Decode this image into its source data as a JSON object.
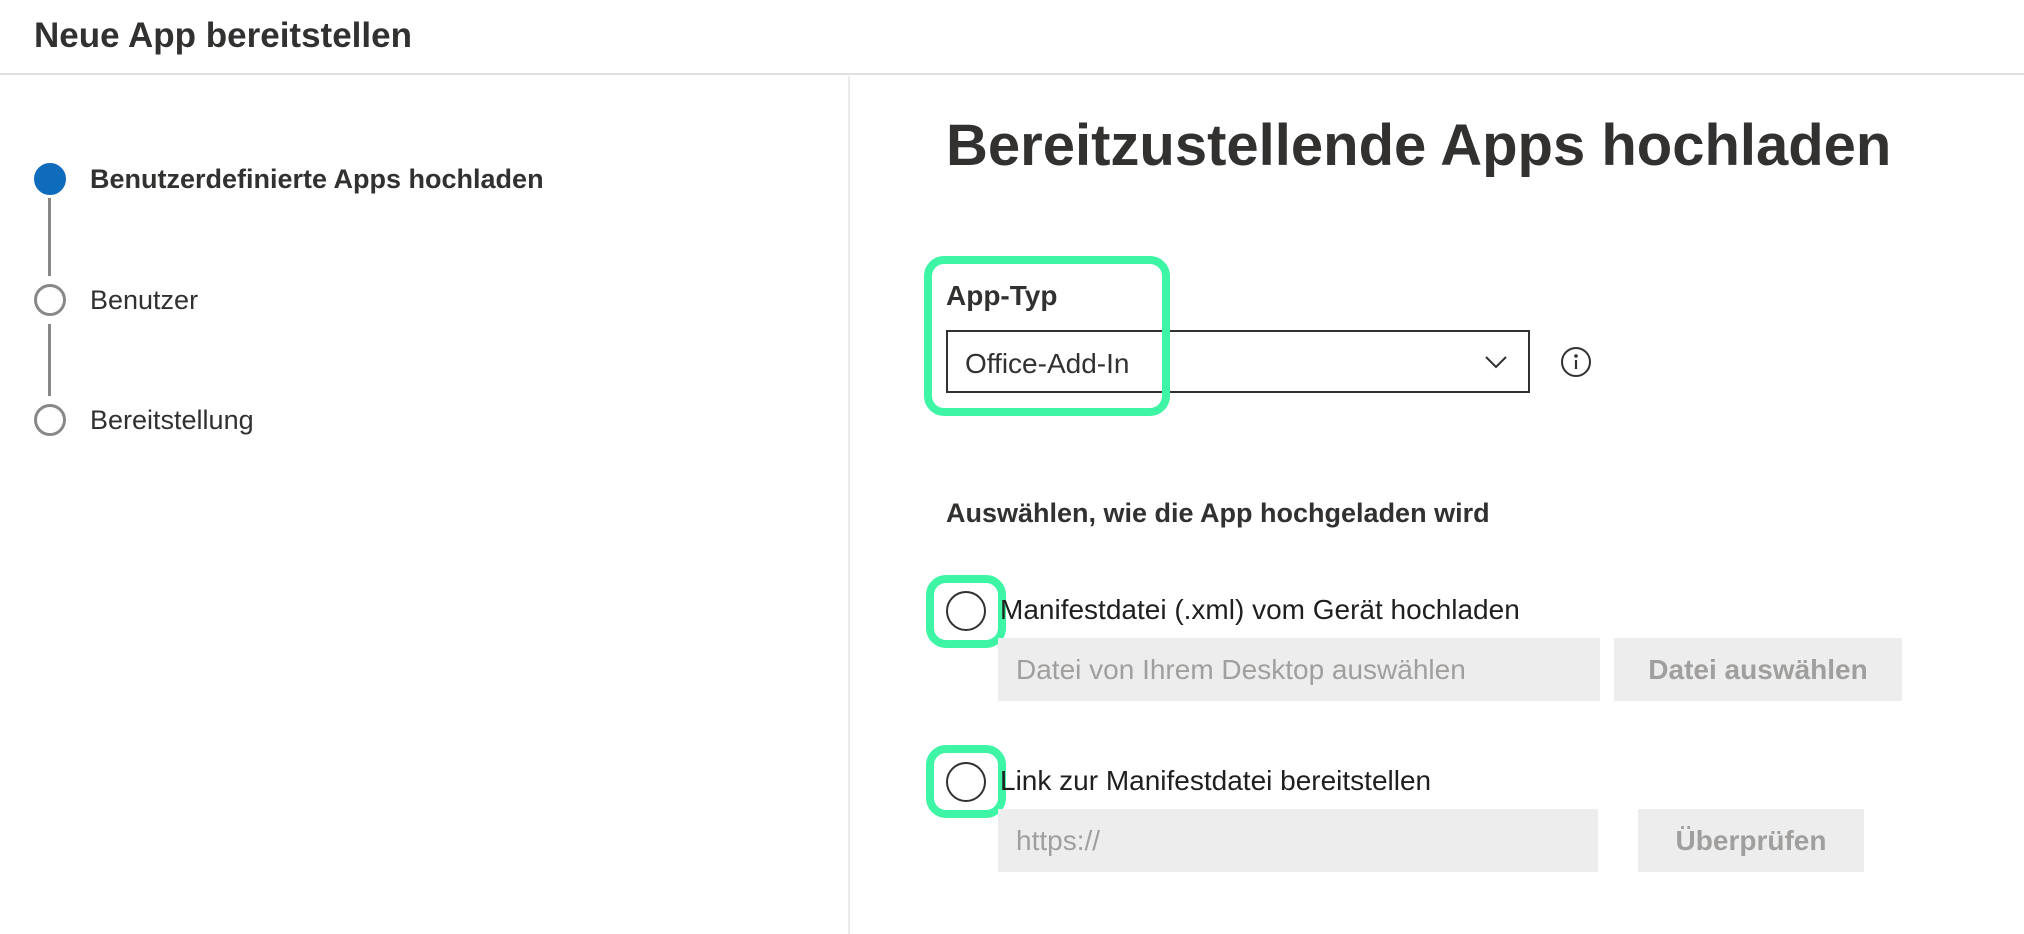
{
  "header": {
    "title": "Neue App bereitstellen"
  },
  "stepper": {
    "steps": [
      {
        "label": "Benutzerdefinierte Apps hochladen",
        "active": true
      },
      {
        "label": "Benutzer",
        "active": false
      },
      {
        "label": "Bereitstellung",
        "active": false
      }
    ]
  },
  "main": {
    "title": "Bereitzustellende Apps hochladen",
    "app_type": {
      "label": "App-Typ",
      "selected": "Office-Add-In"
    },
    "upload_method": {
      "label": "Auswählen, wie die App hochgeladen wird",
      "options": [
        {
          "label": "Manifestdatei (.xml) vom Gerät hochladen",
          "input_placeholder": "Datei von Ihrem Desktop auswählen",
          "button_label": "Datei auswählen"
        },
        {
          "label": "Link zur Manifestdatei bereitstellen",
          "input_placeholder": "https://",
          "button_label": "Überprüfen"
        }
      ]
    }
  },
  "colors": {
    "accent": "#0f6cbd",
    "highlight": "#3df5a4",
    "disabled_bg": "#ededed",
    "disabled_text": "#a19f9d"
  },
  "icons": {
    "dropdown": "chevron-down-icon",
    "info": "info-icon"
  }
}
